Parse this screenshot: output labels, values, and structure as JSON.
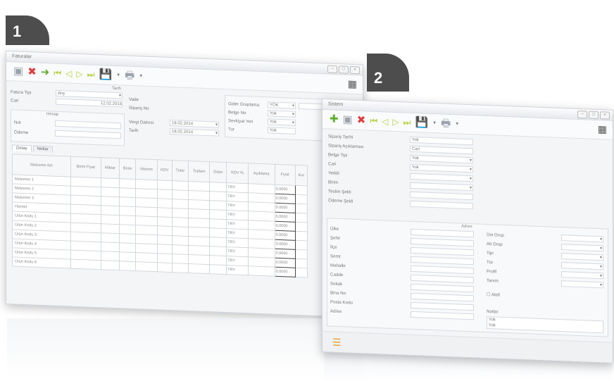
{
  "badges": {
    "one": "1",
    "two": "2"
  },
  "window1": {
    "title": "Faturalar",
    "form": {
      "labels": [
        "Fatura Tipi",
        "Cari",
        "Vade",
        "Sipariş No",
        "Not",
        "Ödeme",
        "Vergi Dairesi",
        "Tarih"
      ],
      "values": [
        "Alış",
        "12.02.2014",
        "18.02.2014",
        "18.02.2014"
      ],
      "right_labels": [
        "Gider Gruplama",
        "Belge No",
        "Sevkiyat Yeri",
        "Tur"
      ],
      "right_values": [
        "YOK",
        "Yok",
        "Yok",
        "Yok"
      ],
      "group_titles": [
        "Tarih",
        "Hesap"
      ]
    },
    "tabs": [
      "Detay",
      "Notlar"
    ],
    "grid": {
      "headers": [
        "Malzeme Adı",
        "Birim Fiyat",
        "Miktar",
        "Birim",
        "İskonto",
        "KDV",
        "Tutar",
        "Toplam",
        "Depo",
        "KDV %",
        "Açıklama",
        "Fiyat",
        "Kur"
      ],
      "rows": [
        "Malzeme 1",
        "Malzeme 2",
        "Malzeme 3",
        "Hizmet",
        "Ürün Kodu 1",
        "Ürün Kodu 2",
        "Ürün Kodu 3",
        "Ürün Kodu 4",
        "Ürün Kodu 5",
        "Ürün Kodu 6"
      ],
      "cell_values": [
        "TRY",
        "0,0000"
      ]
    }
  },
  "window2": {
    "title": "Sistem",
    "labels": [
      "Sipariş Tarihi",
      "Sipariş Açıklaması",
      "Belge Tipi",
      "Cari",
      "Yetkili",
      "Birim",
      "Teslim Şekli",
      "Ödeme Şekli"
    ],
    "values": [
      "Yok",
      "Cari",
      "Yok",
      "Yok"
    ],
    "group_title": "Adres",
    "address_labels": [
      "Ülke",
      "Şehir",
      "İlçe",
      "Semt",
      "Mahalle",
      "Cadde",
      "Sokak",
      "Bina No",
      "Posta Kodu",
      "Adres"
    ],
    "right_labels": [
      "Üst Grup",
      "Alt Grup",
      "Tipi",
      "Tür",
      "Profil",
      "Tanım"
    ],
    "checkbox": "Aktif",
    "notes_label": "Notlar",
    "notes_values": [
      "Yok",
      "Yok"
    ]
  },
  "colors": {
    "badge": "#4d4d4d",
    "accent_green": "#5fae2e",
    "accent_red": "#e03b3b",
    "nav": "#b7cf3c"
  }
}
